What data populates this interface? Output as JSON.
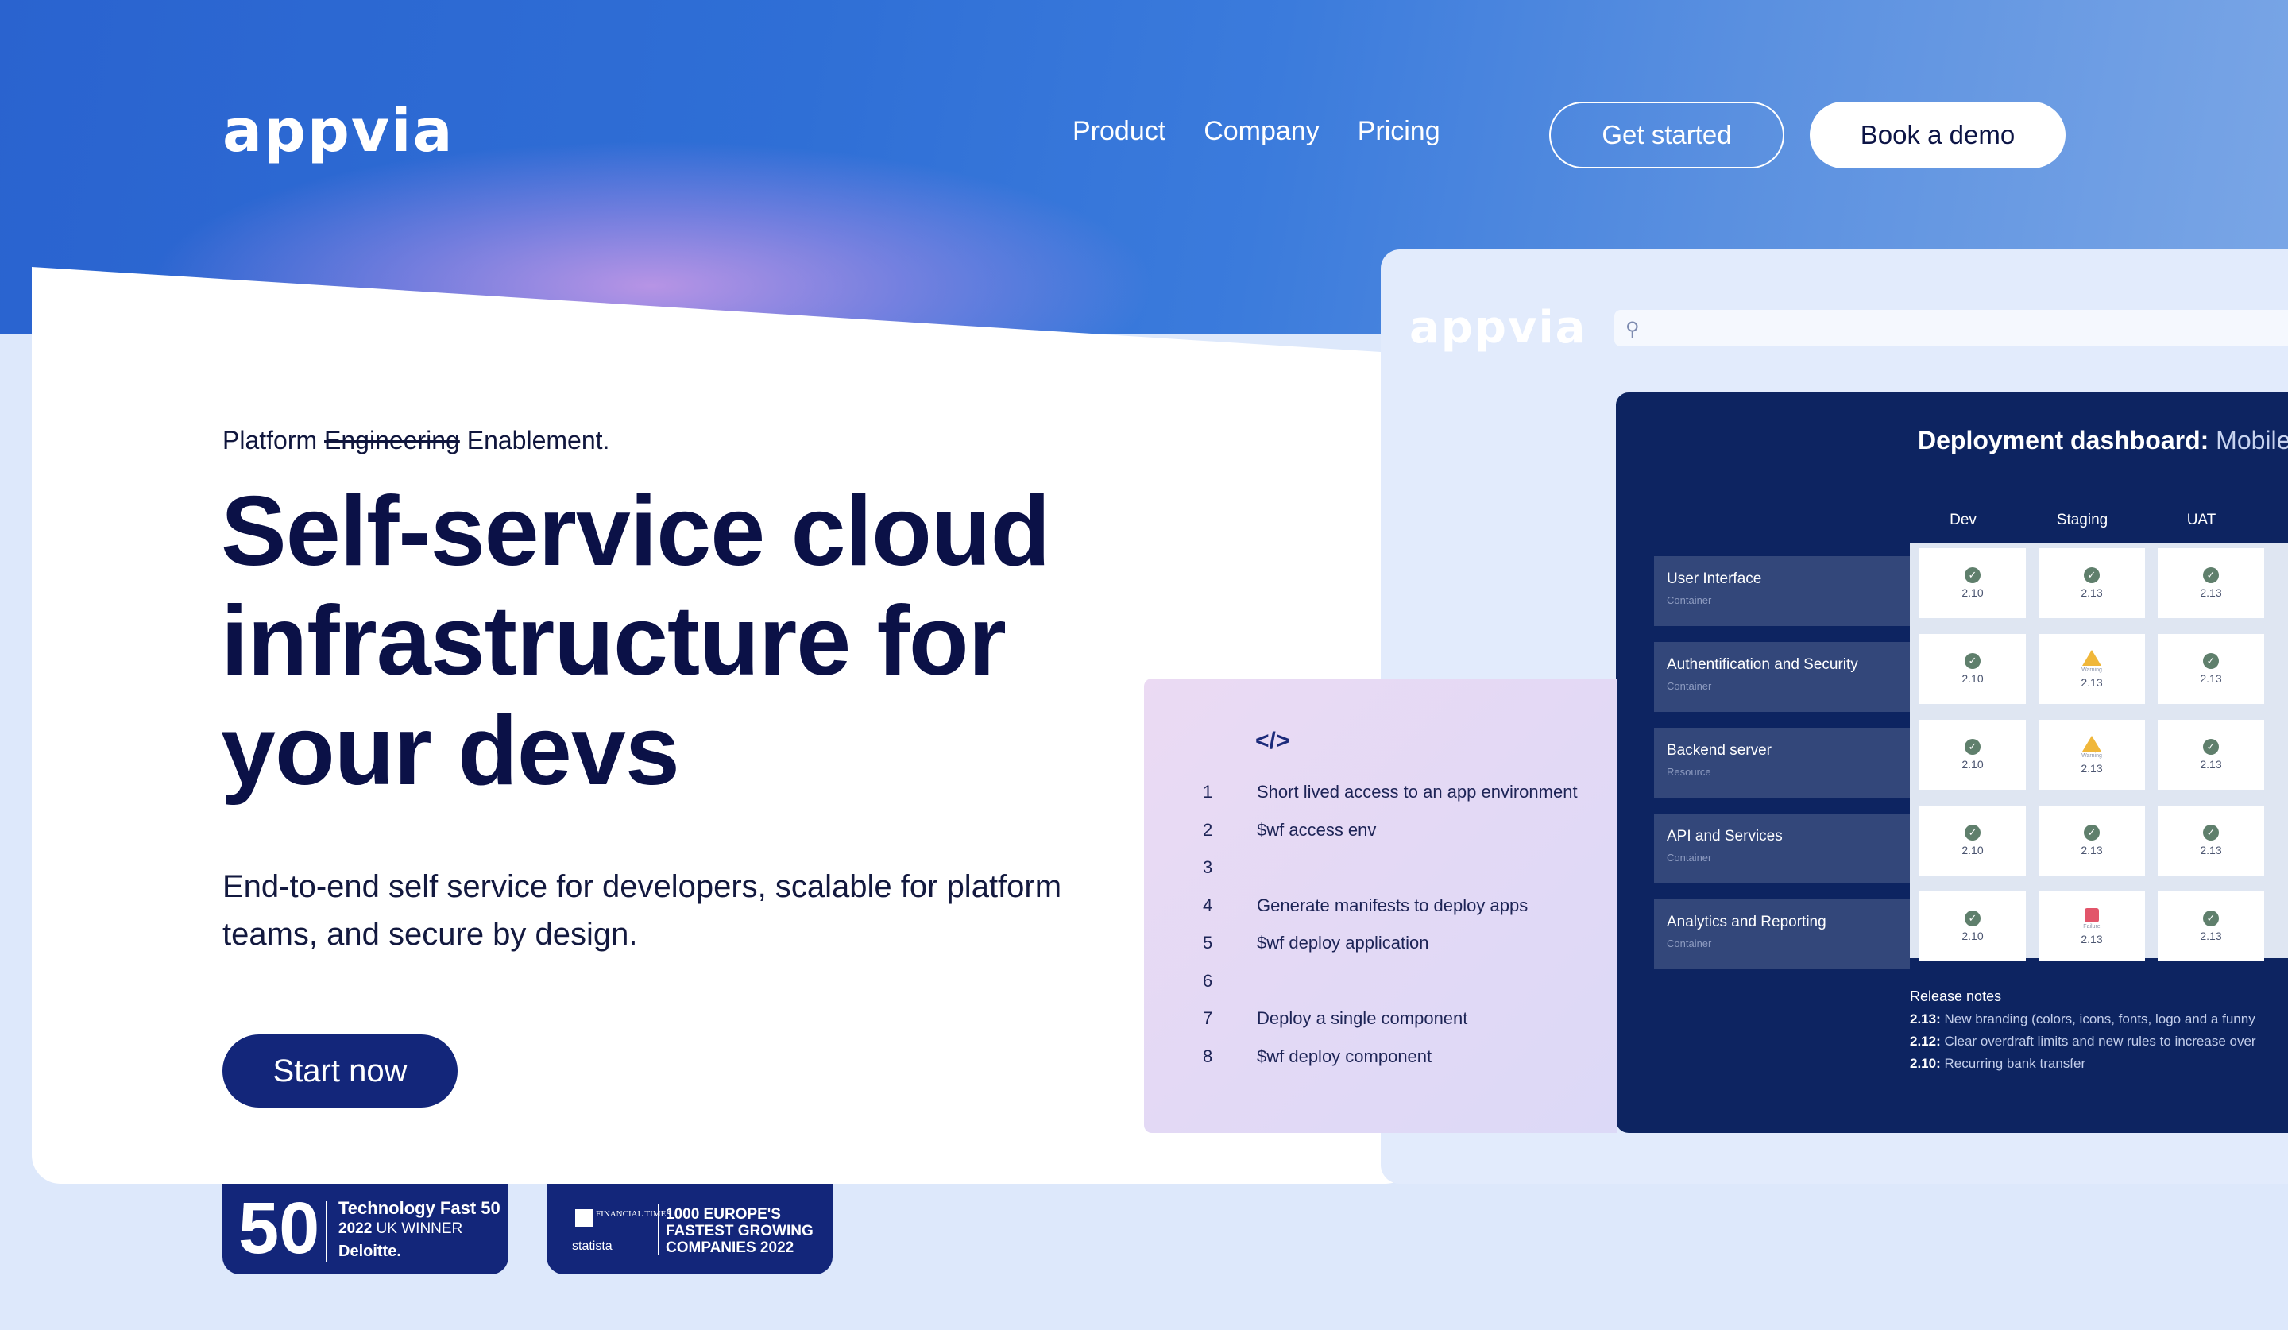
{
  "header": {
    "logo": "appvia",
    "nav": [
      "Product",
      "Company",
      "Pricing"
    ],
    "get_started": "Get started",
    "book_demo": "Book a demo"
  },
  "hero": {
    "tagline_prefix": "Platform",
    "tagline_struck": "Engineering",
    "tagline_suffix": "Enablement.",
    "headline_lines": [
      "Self-service cloud",
      "infrastructure for",
      "your devs"
    ],
    "subtext": "End-to-end self service for developers, scalable for platform teams, and secure by design.",
    "cta": "Start now"
  },
  "awards": {
    "deloitte": {
      "big": "50",
      "line1": "Technology Fast 50",
      "line2_bold": "2022",
      "line2_rest": " UK WINNER",
      "line3": "Deloitte."
    },
    "ft": {
      "ft_logo": "FINANCIAL TIMES",
      "statista": "statista",
      "text": "1000 EUROPE'S FASTEST GROWING COMPANIES 2022"
    }
  },
  "app": {
    "logo": "appvia",
    "search_icon": "search-icon",
    "dashboard": {
      "title_bold": "Deployment dashboard:",
      "title_rest": " Mobile",
      "columns": [
        "Dev",
        "Staging",
        "UAT"
      ],
      "rows": [
        {
          "name": "User Interface",
          "type": "Container",
          "cells": [
            {
              "status": "ok",
              "version": "2.10"
            },
            {
              "status": "ok",
              "version": "2.13"
            },
            {
              "status": "ok",
              "version": "2.13"
            }
          ]
        },
        {
          "name": "Authentification and Security",
          "type": "Container",
          "cells": [
            {
              "status": "ok",
              "version": "2.10"
            },
            {
              "status": "warning",
              "label": "Warning",
              "version": "2.13"
            },
            {
              "status": "ok",
              "version": "2.13"
            }
          ]
        },
        {
          "name": "Backend server",
          "type": "Resource",
          "cells": [
            {
              "status": "ok",
              "version": "2.10"
            },
            {
              "status": "warning",
              "label": "Warning",
              "version": "2.13"
            },
            {
              "status": "ok",
              "version": "2.13"
            }
          ]
        },
        {
          "name": "API and Services",
          "type": "Container",
          "cells": [
            {
              "status": "ok",
              "version": "2.10"
            },
            {
              "status": "ok",
              "version": "2.13"
            },
            {
              "status": "ok",
              "version": "2.13"
            }
          ]
        },
        {
          "name": "Analytics and Reporting",
          "type": "Container",
          "cells": [
            {
              "status": "ok",
              "version": "2.10"
            },
            {
              "status": "failure",
              "label": "Failure",
              "version": "2.13"
            },
            {
              "status": "ok",
              "version": "2.13"
            }
          ]
        }
      ],
      "release_title": "Release notes",
      "release_notes": [
        {
          "version": "2.13:",
          "text": " New branding (colors, icons, fonts, logo and a funny"
        },
        {
          "version": "2.12:",
          "text": " Clear overdraft limits and new rules to increase over"
        },
        {
          "version": "2.10:",
          "text": " Recurring bank transfer"
        }
      ]
    },
    "code": {
      "icon": "</>",
      "lines": [
        {
          "n": "1",
          "text": "Short lived access to an app environment"
        },
        {
          "n": "2",
          "text": "$wf access env"
        },
        {
          "n": "3",
          "text": ""
        },
        {
          "n": "4",
          "text": "Generate manifests to deploy apps"
        },
        {
          "n": "5",
          "text": "$wf deploy application"
        },
        {
          "n": "6",
          "text": ""
        },
        {
          "n": "7",
          "text": "Deploy a single component"
        },
        {
          "n": "8",
          "text": "$wf deploy component"
        }
      ]
    }
  }
}
